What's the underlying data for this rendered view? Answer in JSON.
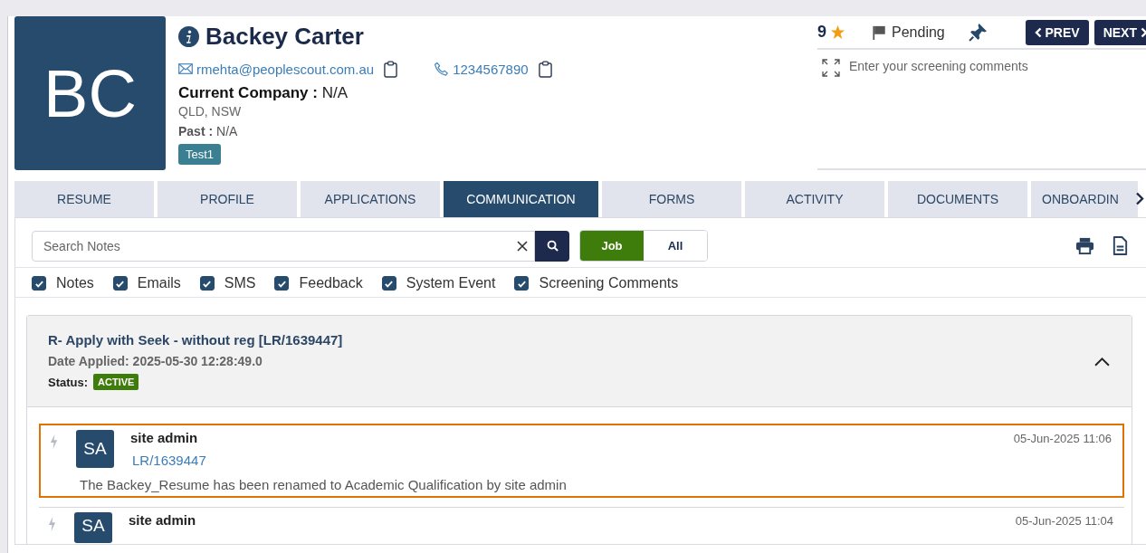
{
  "candidate": {
    "initials": "BC",
    "name": "Backey Carter",
    "email": "rmehta@peoplescout.com.au",
    "phone": "1234567890",
    "company_label": "Current Company :",
    "company": "N/A",
    "location": "QLD, NSW",
    "past_label": "Past :",
    "past": "N/A",
    "tags": [
      "Test1"
    ]
  },
  "summary": {
    "rating": "9",
    "status": "Pending",
    "pinned": true,
    "prev_button": "PREV",
    "next_button": "NEXT",
    "comments_placeholder": "Enter your screening comments"
  },
  "tabs": [
    {
      "label": "RESUME",
      "selected": false
    },
    {
      "label": "PROFILE",
      "selected": false
    },
    {
      "label": "APPLICATIONS",
      "selected": false
    },
    {
      "label": "COMMUNICATION",
      "selected": true
    },
    {
      "label": "FORMS",
      "selected": false
    },
    {
      "label": "ACTIVITY",
      "selected": false
    },
    {
      "label": "DOCUMENTS",
      "selected": false
    },
    {
      "label": "ONBOARDIN",
      "selected": false
    }
  ],
  "search": {
    "placeholder": "Search Notes"
  },
  "scope": [
    {
      "label": "Job",
      "selected": true
    },
    {
      "label": "All",
      "selected": false
    }
  ],
  "filters": [
    {
      "label": "Notes",
      "checked": true
    },
    {
      "label": "Emails",
      "checked": true
    },
    {
      "label": "SMS",
      "checked": true
    },
    {
      "label": "Feedback",
      "checked": true
    },
    {
      "label": "System Event",
      "checked": true
    },
    {
      "label": "Screening Comments",
      "checked": true
    }
  ],
  "application": {
    "title": "R- Apply with Seek - without reg [LR/1639447]",
    "date_label": "Date Applied:",
    "date": "2025-05-30 12:28:49.0",
    "status_label": "Status:",
    "status": "ACTIVE",
    "expanded": true,
    "entries": [
      {
        "initials": "SA",
        "author": "site admin",
        "reference": "LR/1639447",
        "message": "The Backey_Resume has been renamed to Academic Qualification by site admin",
        "time": "05-Jun-2025 11:06",
        "highlighted": true
      },
      {
        "initials": "SA",
        "author": "site admin",
        "time": "05-Jun-2025 11:04",
        "highlighted": false
      }
    ]
  }
}
